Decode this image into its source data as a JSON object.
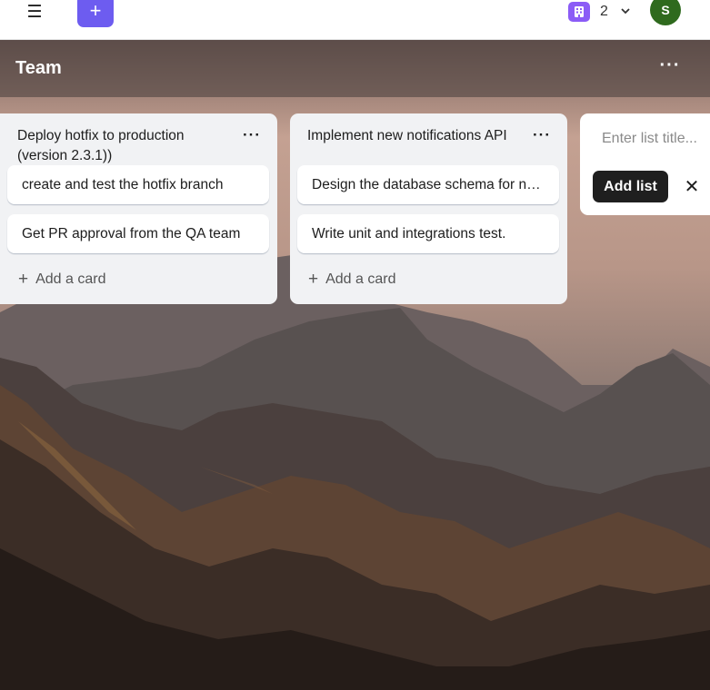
{
  "topbar": {
    "menu_icon": "hamburger-icon",
    "create_icon": "plus-icon",
    "workspace_icon": "building-icon",
    "workspace_count": "2",
    "avatar_initial": "S",
    "avatar_color": "#2f6a1e",
    "create_color": "#6d5cf0"
  },
  "board": {
    "title": "Team",
    "more_label": "···"
  },
  "lists": [
    {
      "title": "Deploy hotfix to production (version 2.3.1))",
      "more_label": "···",
      "cards": [
        "create and test the hotfix branch",
        "Get PR approval from the QA team"
      ],
      "add_card_label": "Add a card"
    },
    {
      "title": "Implement new notifications API",
      "more_label": "···",
      "cards": [
        "Design the database schema for notifications",
        "Write unit and integrations test."
      ],
      "add_card_label": "Add a card"
    }
  ],
  "composer": {
    "placeholder": "Enter list title...",
    "add_list_label": "Add list",
    "close_label": "✕"
  }
}
